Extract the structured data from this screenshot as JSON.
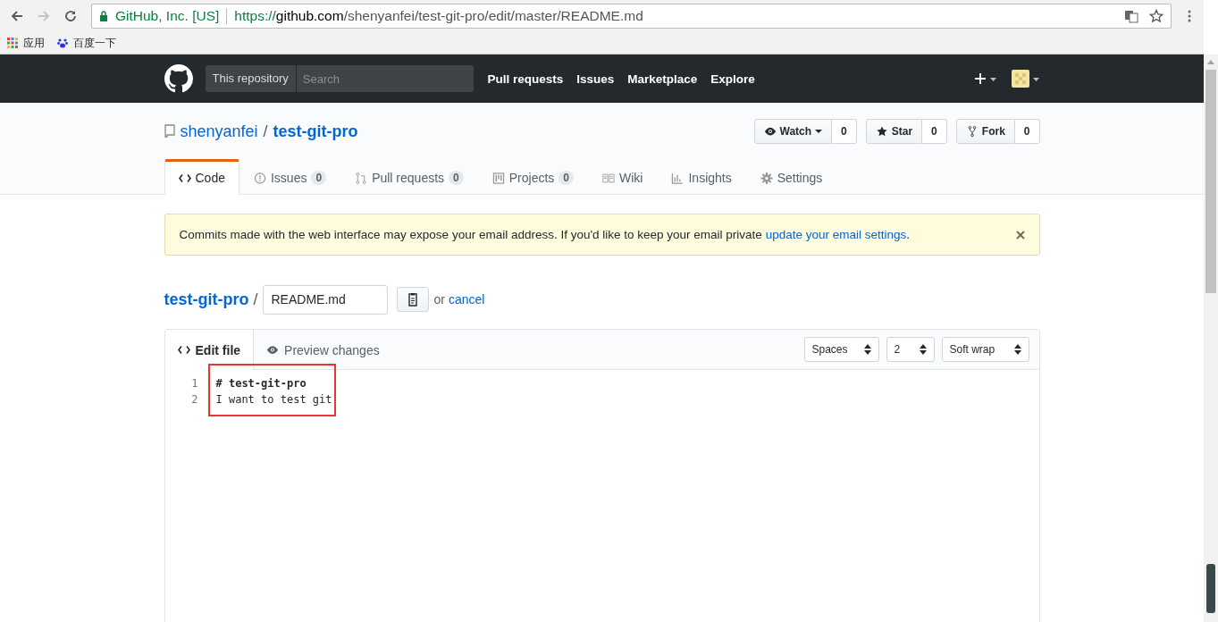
{
  "browser": {
    "site_identity": "GitHub, Inc. [US]",
    "url_scheme": "https://",
    "url_host": "github.com",
    "url_path": "/shenyanfei/test-git-pro/edit/master/README.md",
    "bookmarks": [
      {
        "kind": "apps",
        "label": "应用"
      },
      {
        "kind": "baidu",
        "label": "百度一下"
      }
    ]
  },
  "header": {
    "scope": "This repository",
    "search": {
      "placeholder": "Search"
    },
    "nav": [
      "Pull requests",
      "Issues",
      "Marketplace",
      "Explore"
    ]
  },
  "repo": {
    "owner": "shenyanfei",
    "separator": "/",
    "name": "test-git-pro",
    "actions": [
      {
        "kind": "watch",
        "label": "Watch",
        "count": "0"
      },
      {
        "kind": "star",
        "label": "Star",
        "count": "0"
      },
      {
        "kind": "fork",
        "label": "Fork",
        "count": "0"
      }
    ],
    "tabs": [
      {
        "kind": "code",
        "label": "Code",
        "selected": true
      },
      {
        "kind": "issues",
        "label": "Issues",
        "count": "0",
        "selected": false
      },
      {
        "kind": "pulls",
        "label": "Pull requests",
        "count": "0",
        "selected": false
      },
      {
        "kind": "projects",
        "label": "Projects",
        "count": "0",
        "selected": false
      },
      {
        "kind": "wiki",
        "label": "Wiki",
        "selected": false
      },
      {
        "kind": "insights",
        "label": "Insights",
        "selected": false
      },
      {
        "kind": "settings",
        "label": "Settings",
        "selected": false
      }
    ]
  },
  "flash": {
    "text": "Commits made with the web interface may expose your email address. If you'd like to keep your email private",
    "link": "update your email settings",
    "after": "."
  },
  "editor": {
    "root": "test-git-pro",
    "separator": "/",
    "filename": "README.md",
    "or": "or",
    "cancel": "cancel",
    "tabs": [
      {
        "kind": "code",
        "label": "Edit file",
        "selected": true
      },
      {
        "kind": "preview",
        "label": "Preview changes",
        "selected": false
      }
    ],
    "selects": [
      "Spaces",
      "2",
      "Soft wrap"
    ],
    "lines": [
      {
        "number": "1",
        "text": "# test-git-pro",
        "bold": true
      },
      {
        "number": "2",
        "text": "I want to test git",
        "bold": false
      }
    ]
  }
}
